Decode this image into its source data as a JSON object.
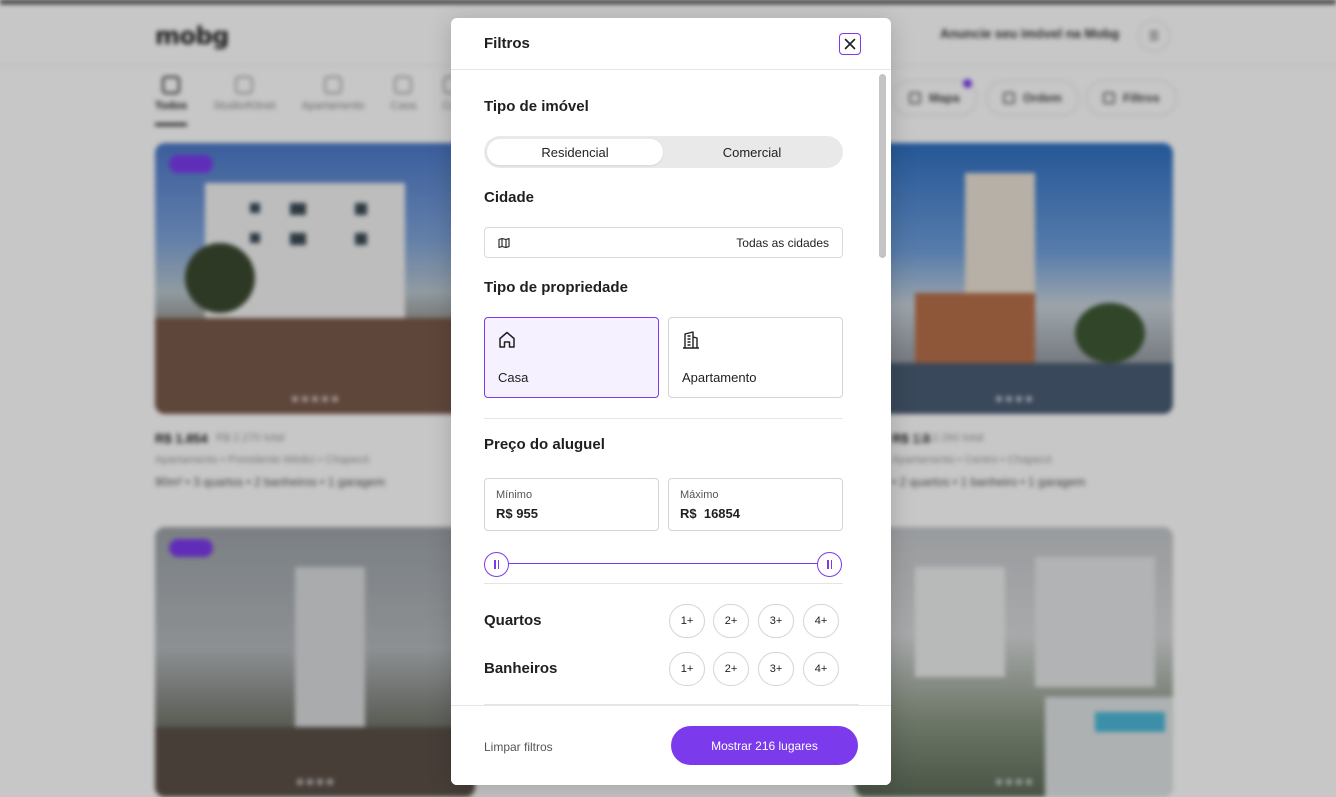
{
  "background": {
    "logo": "mobg",
    "announce": "Anuncie seu imóvel na Mobg",
    "categories": [
      "Todos",
      "Studio/Kitnet",
      "Apartamento",
      "Casa",
      "Cob"
    ],
    "pills": [
      "Mapa",
      "Ordem",
      "Filtros"
    ],
    "cards": [
      {
        "price": "R$ 1.854",
        "price_extra": "R$ 2.270 total",
        "location": "Apartamento • Presidente Médici • Chapecó",
        "features": "90m² • 3 quartos • 2 banheiros • 1 garagem"
      },
      {
        "price": "R$ 1.8",
        "price_extra": "R$ 2.260 total",
        "location": "Apartamento • Centro • Chapecó",
        "features": "• 2 quartos • 1 banheiro • 1 garagem"
      }
    ],
    "colors": {
      "accent": "#7c3aed"
    }
  },
  "modal": {
    "title": "Filtros",
    "close_icon": "close-icon",
    "property_kind": {
      "title": "Tipo de imóvel",
      "options": [
        "Residencial",
        "Comercial"
      ],
      "selected": "Residencial"
    },
    "city": {
      "title": "Cidade",
      "icon": "map-icon",
      "value": "Todas as cidades"
    },
    "property_type": {
      "title": "Tipo de propriedade",
      "options": [
        {
          "label": "Casa",
          "icon": "house-icon",
          "selected": true
        },
        {
          "label": "Apartamento",
          "icon": "building-icon",
          "selected": false
        }
      ]
    },
    "rent_price": {
      "title": "Preço do aluguel",
      "min_label": "Mínimo",
      "min_value": "R$ 955",
      "max_label": "Máximo",
      "max_value": "R$  16854"
    },
    "rooms": {
      "title": "Quartos",
      "options": [
        "1+",
        "2+",
        "3+",
        "4+"
      ]
    },
    "bathrooms": {
      "title": "Banheiros",
      "options": [
        "1+",
        "2+",
        "3+",
        "4+"
      ]
    },
    "footer": {
      "clear_label": "Limpar filtros",
      "show_label": "Mostrar 216 lugares"
    }
  }
}
